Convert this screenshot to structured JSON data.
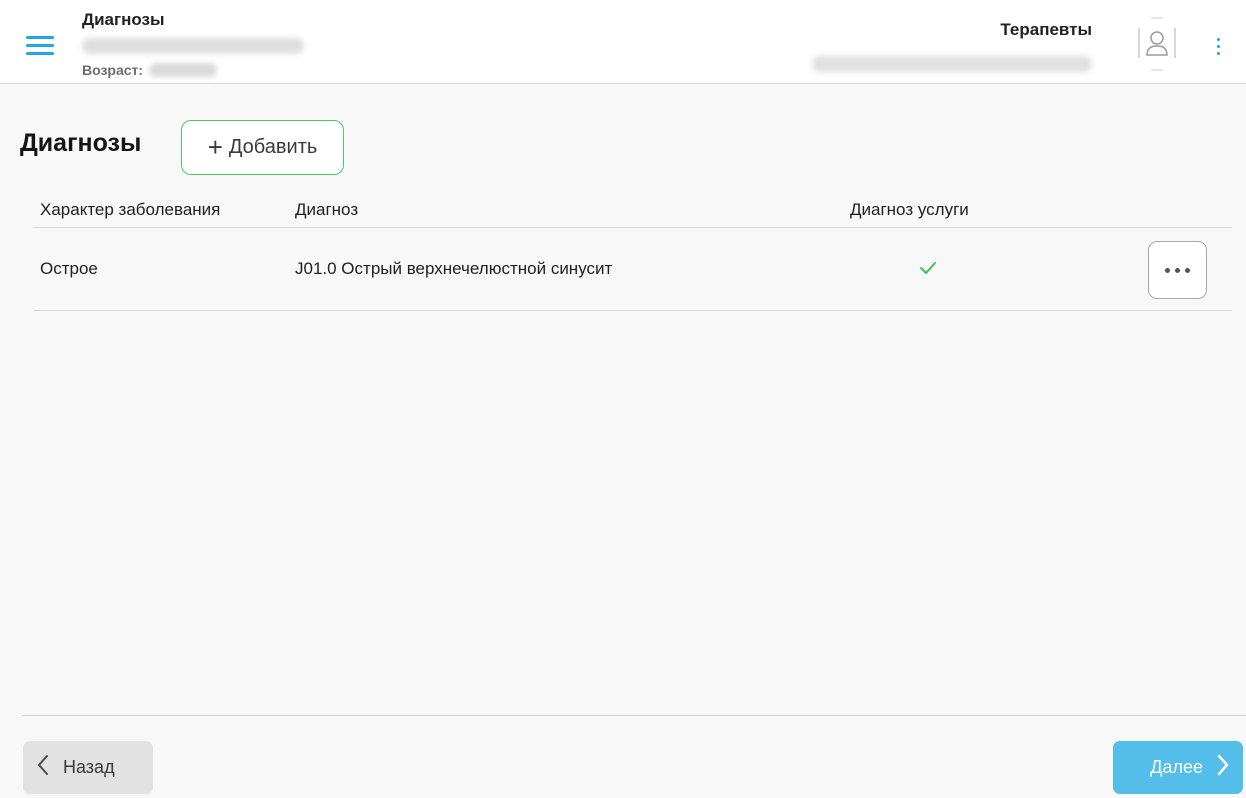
{
  "header": {
    "title": "Диагнозы",
    "age_label": "Возраст:",
    "role": "Терапевты"
  },
  "section": {
    "title": "Диагнозы",
    "add_label": "Добавить"
  },
  "table": {
    "columns": [
      "Характер заболевания",
      "Диагноз",
      "Диагноз услуги"
    ],
    "rows": [
      {
        "character": "Острое",
        "diagnosis": "J01.0 Острый верхнечелюстной синусит",
        "service_diagnosis": true
      }
    ]
  },
  "footer": {
    "back_label": "Назад",
    "next_label": "Далее"
  },
  "colors": {
    "accent": "#1ea7e1",
    "add_border": "#4cc967",
    "check": "#3cc35a",
    "next_button": "#52bee9",
    "back_button": "#e2e2e2"
  },
  "icons": [
    "menu-icon",
    "user-avatar-icon",
    "more-vertical-icon",
    "plus-icon",
    "check-icon",
    "more-horizontal-icon",
    "chevron-left-icon",
    "chevron-right-icon"
  ]
}
